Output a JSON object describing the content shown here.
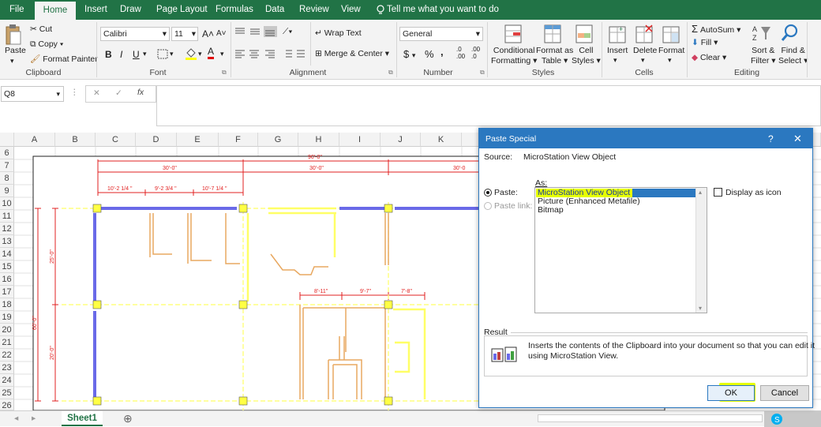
{
  "tabs": [
    "File",
    "Home",
    "Insert",
    "Draw",
    "Page Layout",
    "Formulas",
    "Data",
    "Review",
    "View"
  ],
  "tell_me": "Tell me what you want to do",
  "clipboard": {
    "paste": "Paste",
    "cut": "Cut",
    "copy": "Copy",
    "format_painter": "Format Painter",
    "label": "Clipboard"
  },
  "font": {
    "name": "Calibri",
    "size": "11",
    "bold": "B",
    "italic": "I",
    "underline": "U",
    "grow": "A˄",
    "shrink": "A˅",
    "font_color_letter": "A",
    "label": "Font"
  },
  "alignment": {
    "wrap_text": "Wrap Text",
    "merge_center": "Merge & Center",
    "label": "Alignment"
  },
  "number": {
    "format": "General",
    "currency": "$",
    "percent": "%",
    "comma": ",",
    "inc_decimal": ".00",
    "dec_decimal": ".0",
    "label": "Number"
  },
  "styles": {
    "conditional": "Conditional",
    "conditional2": "Formatting",
    "format_table": "Format as",
    "format_table2": "Table",
    "cell_styles": "Cell",
    "cell_styles2": "Styles",
    "label": "Styles"
  },
  "cells": {
    "insert": "Insert",
    "delete": "Delete",
    "format": "Format",
    "label": "Cells"
  },
  "editing": {
    "autosum": "AutoSum",
    "fill": "Fill",
    "clear": "Clear",
    "sort": "Sort &",
    "sort2": "Filter",
    "find": "Find &",
    "find2": "Select",
    "label": "Editing"
  },
  "formula_bar": {
    "name_box": "Q8",
    "fx": "fx",
    "cancel": "✕",
    "enter": "✓"
  },
  "columns": [
    "A",
    "B",
    "C",
    "D",
    "E",
    "F",
    "G",
    "H",
    "I",
    "J",
    "K"
  ],
  "rows": [
    "6",
    "7",
    "8",
    "9",
    "10",
    "11",
    "12",
    "13",
    "14",
    "15",
    "16",
    "17",
    "18",
    "19",
    "20",
    "21",
    "22",
    "23",
    "24",
    "25",
    "26"
  ],
  "drawing": {
    "dim_total": "90'-0\"",
    "dim_30a": "30'-0\"",
    "dim_30b": "30'-0\"",
    "dim_30c": "30'-0",
    "dim_a": "10'-2  1/4  \"",
    "dim_b": "9'-2  3/4  \"",
    "dim_c": "10'-7  1/4  \"",
    "dim_d": "8'-11\"",
    "dim_e": "9'-7\"",
    "dim_f": "7'-8\"",
    "dim_v1": "25'-0\"",
    "dim_v2": "20'-0\"",
    "dim_v3": "60'-0\""
  },
  "sheet_tab": "Sheet1",
  "dialog": {
    "title": "Paste Special",
    "help": "?",
    "close": "✕",
    "source_label": "Source:",
    "source_value": "MicroStation View Object",
    "as_label": "As:",
    "paste_label": "Paste:",
    "paste_link_label": "Paste link:",
    "options": [
      "MicroStation View Object",
      "Picture (Enhanced Metafile)",
      "Bitmap"
    ],
    "display_as_icon": "Display as icon",
    "result_label": "Result",
    "result_text_1": "Inserts the contents of the Clipboard into your document so that you can edit it",
    "result_text_2": "using MicroStation View.",
    "ok": "OK",
    "cancel": "Cancel"
  },
  "colors": {
    "excel_green": "#217346",
    "dialog_blue": "#2b78c0",
    "highlight": "#e6ff00",
    "cad_yellow": "#ffff66",
    "cad_orange": "#e8a860",
    "cad_red": "#e22020",
    "cad_blue": "#6a6ae8"
  }
}
